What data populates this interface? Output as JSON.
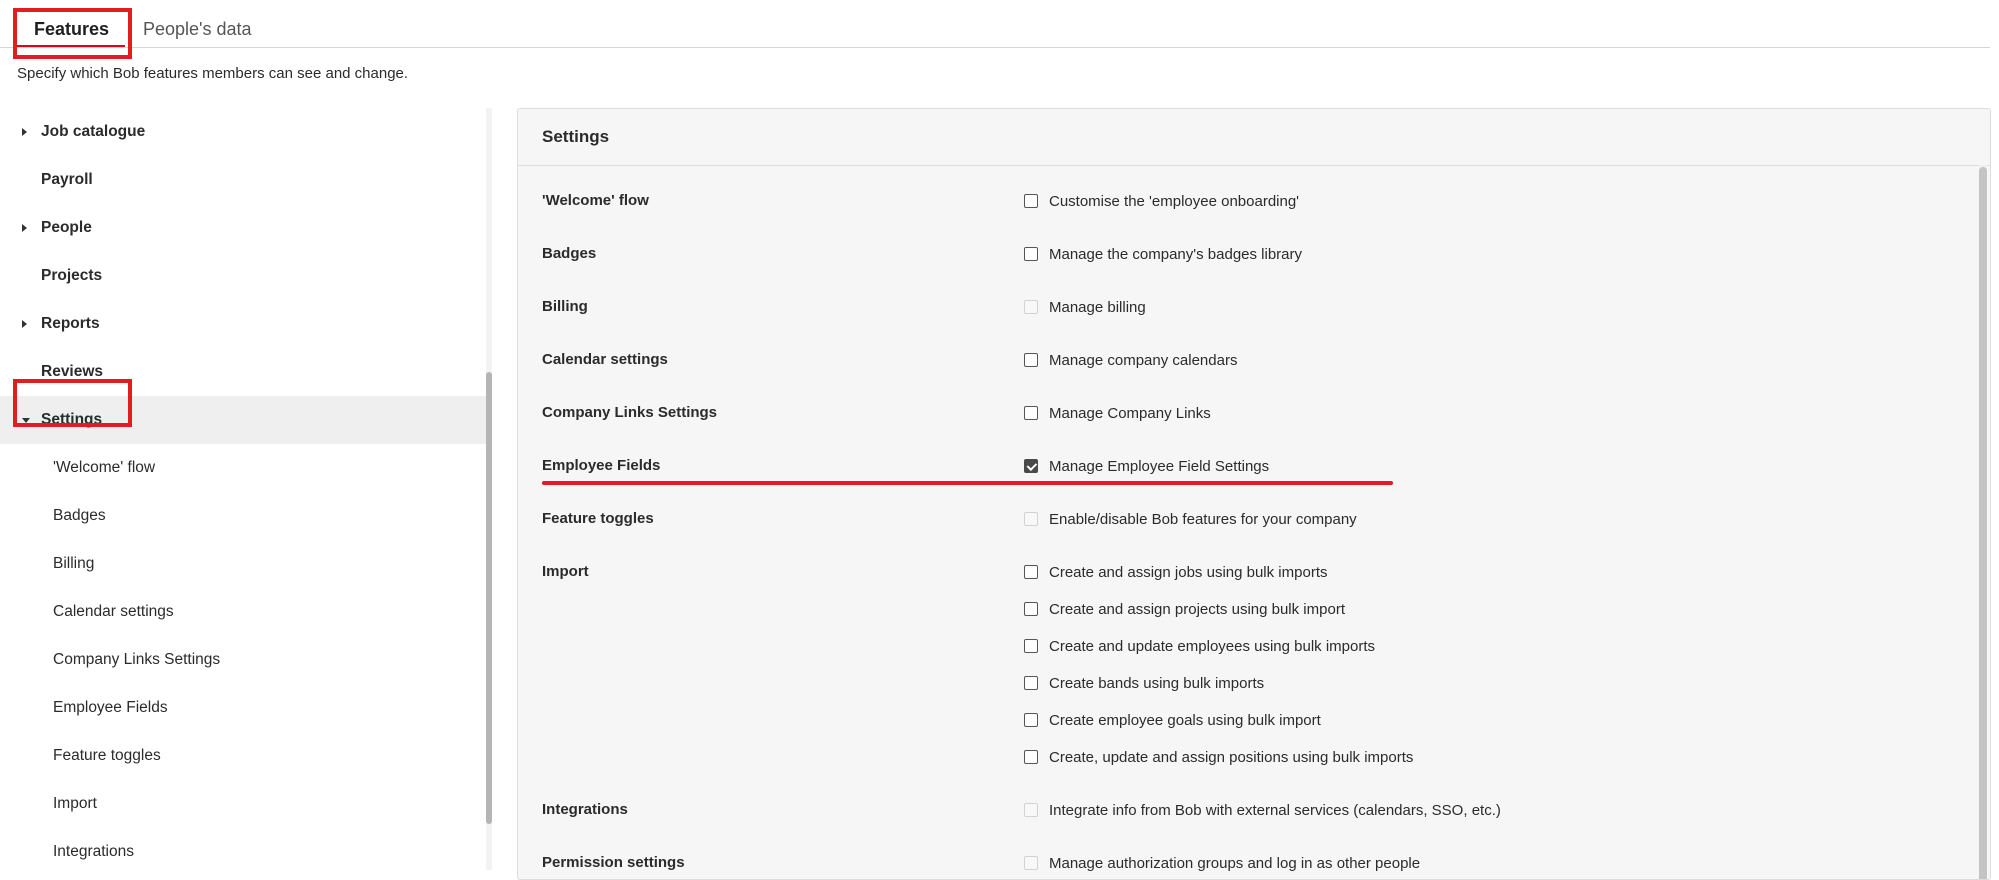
{
  "tabs": [
    {
      "label": "Features"
    },
    {
      "label": "People's data"
    }
  ],
  "description": "Specify which Bob features members can see and change.",
  "sidebar": {
    "items": [
      {
        "label": "Job catalogue"
      },
      {
        "label": "Payroll"
      },
      {
        "label": "People"
      },
      {
        "label": "Projects"
      },
      {
        "label": "Reports"
      },
      {
        "label": "Reviews"
      },
      {
        "label": "Settings"
      }
    ],
    "sub_items": [
      {
        "label": "'Welcome' flow"
      },
      {
        "label": "Badges"
      },
      {
        "label": "Billing"
      },
      {
        "label": "Calendar settings"
      },
      {
        "label": "Company Links Settings"
      },
      {
        "label": "Employee Fields"
      },
      {
        "label": "Feature toggles"
      },
      {
        "label": "Import"
      },
      {
        "label": "Integrations"
      }
    ]
  },
  "panel": {
    "title": "Settings",
    "rows": [
      {
        "label": "'Welcome' flow",
        "options": [
          {
            "label": "Customise the 'employee onboarding'",
            "checked": false,
            "disabled": false
          }
        ]
      },
      {
        "label": "Badges",
        "options": [
          {
            "label": "Manage the company's badges library",
            "checked": false,
            "disabled": false
          }
        ]
      },
      {
        "label": "Billing",
        "options": [
          {
            "label": "Manage billing",
            "checked": false,
            "disabled": true
          }
        ]
      },
      {
        "label": "Calendar settings",
        "options": [
          {
            "label": "Manage company calendars",
            "checked": false,
            "disabled": false
          }
        ]
      },
      {
        "label": "Company Links Settings",
        "options": [
          {
            "label": "Manage Company Links",
            "checked": false,
            "disabled": false
          }
        ]
      },
      {
        "label": "Employee Fields",
        "options": [
          {
            "label": "Manage Employee Field Settings",
            "checked": true,
            "disabled": false
          }
        ]
      },
      {
        "label": "Feature toggles",
        "options": [
          {
            "label": "Enable/disable Bob features for your company",
            "checked": false,
            "disabled": true
          }
        ]
      },
      {
        "label": "Import",
        "options": [
          {
            "label": "Create and assign jobs using bulk imports",
            "checked": false,
            "disabled": false
          },
          {
            "label": "Create and assign projects using bulk import",
            "checked": false,
            "disabled": false
          },
          {
            "label": "Create and update employees using bulk imports",
            "checked": false,
            "disabled": false
          },
          {
            "label": "Create bands using bulk imports",
            "checked": false,
            "disabled": false
          },
          {
            "label": "Create employee goals using bulk import",
            "checked": false,
            "disabled": false
          },
          {
            "label": "Create, update and assign positions using bulk imports",
            "checked": false,
            "disabled": false
          }
        ]
      },
      {
        "label": "Integrations",
        "options": [
          {
            "label": "Integrate info from Bob with external services (calendars, SSO, etc.)",
            "checked": false,
            "disabled": true
          }
        ]
      },
      {
        "label": "Permission settings",
        "options": [
          {
            "label": "Manage authorization groups and log in as other people",
            "checked": false,
            "disabled": true
          }
        ]
      }
    ]
  },
  "colors": {
    "highlight": "#e31b23",
    "checkbox_checked": "#4a4a4a"
  }
}
